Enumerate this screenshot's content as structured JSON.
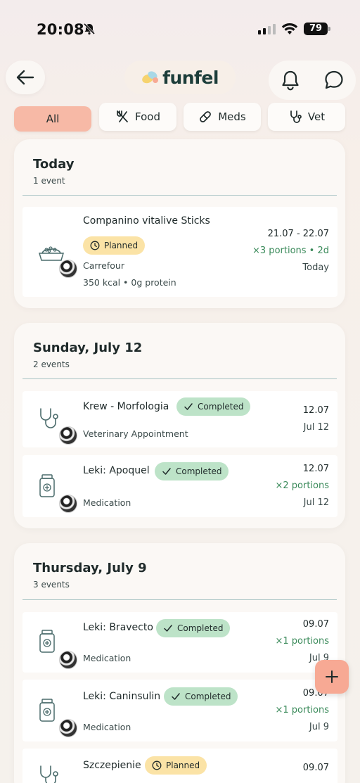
{
  "status": {
    "time": "20:08",
    "battery": "79"
  },
  "header": {
    "logo": "funfel",
    "back_icon": "arrow-left-icon",
    "notification_icon": "bell-icon",
    "chat_icon": "chat-bubble-icon"
  },
  "tabs": [
    {
      "label": "All",
      "icon": ""
    },
    {
      "label": "Food",
      "icon": "fork-knife-icon"
    },
    {
      "label": "Meds",
      "icon": "pill-icon"
    },
    {
      "label": "Vet",
      "icon": "stethoscope-icon"
    }
  ],
  "colors": {
    "accent": "#f7b9a6",
    "planned": "#fbe3a6",
    "completed": "#bde3c8",
    "portion": "#3a8a5a",
    "fab": "#f7a994"
  },
  "sections": [
    {
      "title": "Today",
      "subtitle": "1 event",
      "events": [
        {
          "title": "Companino vitalive Sticks",
          "badge": "Planned",
          "sub1": "Carrefour",
          "sub2": "350 kcal • 0g protein",
          "date": "21.07 - 22.07",
          "portion": "×3 portions • 2d",
          "right": "Today"
        }
      ]
    },
    {
      "title": "Sunday, July 12",
      "subtitle": "2 events",
      "events": [
        {
          "title": "Krew - Morfologia",
          "badge": "Completed",
          "sub1": "Veterinary Appointment",
          "date": "12.07",
          "right": "Jul 12"
        },
        {
          "title": "Leki: Apoquel",
          "badge": "Completed",
          "sub1": "Medication",
          "date": "12.07",
          "portion": "×2 portions",
          "right": "Jul 12"
        }
      ]
    },
    {
      "title": "Thursday, July 9",
      "subtitle": "3 events",
      "events": [
        {
          "title": "Leki: Bravecto",
          "badge": "Completed",
          "sub1": "Medication",
          "date": "09.07",
          "portion": "×1 portions",
          "right": "Jul 9"
        },
        {
          "title": "Leki: Caninsulin",
          "badge": "Completed",
          "sub1": "Medication",
          "date": "09.07",
          "portion": "×1 portions",
          "right": "Jul 9"
        },
        {
          "title": "Szczepienie",
          "badge": "Planned",
          "date": "09.07"
        }
      ]
    }
  ],
  "fab": {
    "label": "+"
  }
}
